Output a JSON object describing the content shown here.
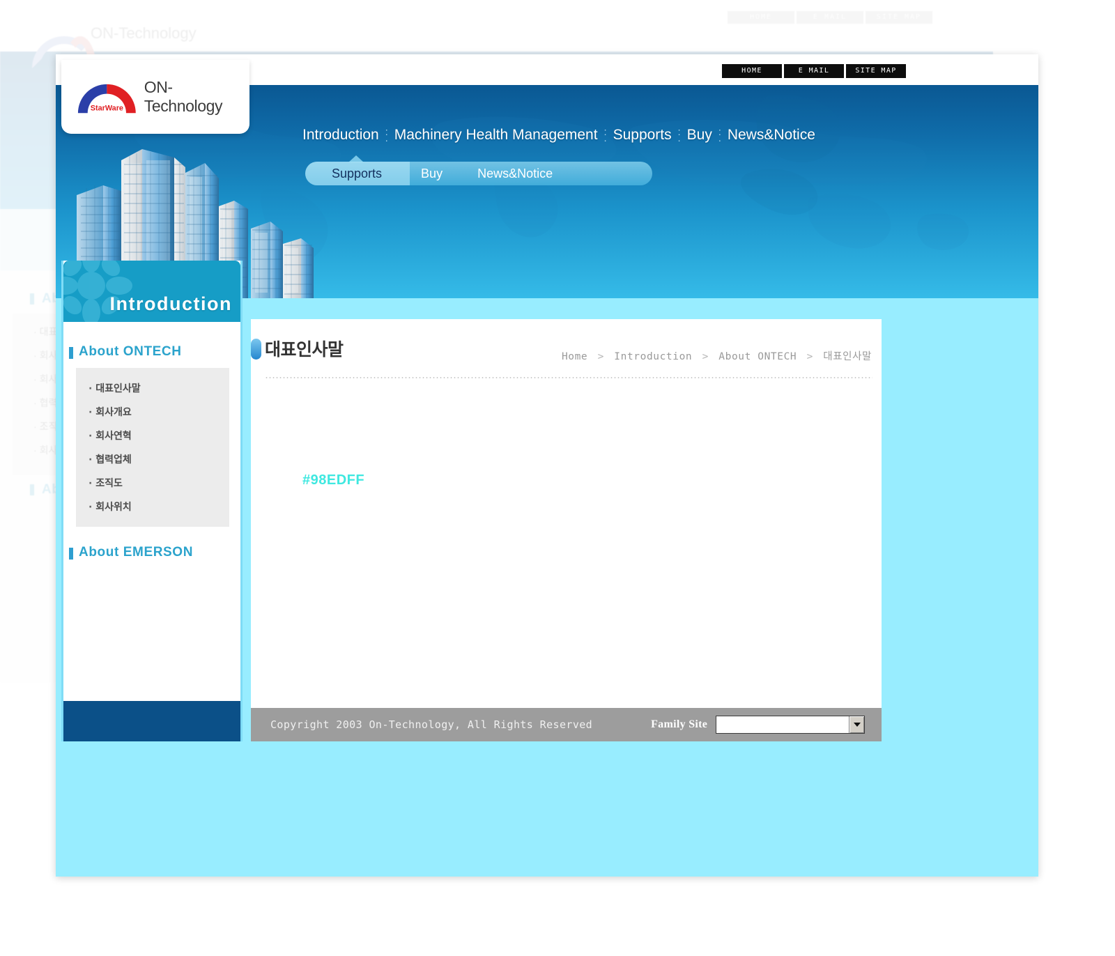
{
  "site": {
    "logo_text": "ON-Technology",
    "logo_badge": "StarWare"
  },
  "utility_nav": [
    {
      "label": "HOME"
    },
    {
      "label": "E MAIL"
    },
    {
      "label": "SITE MAP"
    }
  ],
  "main_nav": [
    {
      "label": "Introduction"
    },
    {
      "label": "Machinery Health Management"
    },
    {
      "label": "Supports"
    },
    {
      "label": "Buy"
    },
    {
      "label": "News&Notice"
    }
  ],
  "sub_nav": [
    {
      "label": "Supports",
      "active": true
    },
    {
      "label": "Buy",
      "active": false
    },
    {
      "label": "News&Notice",
      "active": false
    }
  ],
  "sidebar": {
    "header": "Introduction",
    "sections": [
      {
        "title": "About ONTECH",
        "items": [
          {
            "label": "대표인사말"
          },
          {
            "label": "회사개요"
          },
          {
            "label": "회사연혁"
          },
          {
            "label": "협력업체"
          },
          {
            "label": "조직도"
          },
          {
            "label": "회사위치"
          }
        ]
      },
      {
        "title": "About EMERSON",
        "items": []
      }
    ]
  },
  "page": {
    "title": "대표인사말",
    "breadcrumb": [
      "Home",
      "Introduction",
      "About ONTECH",
      "대표인사말"
    ],
    "breadcrumb_separator": ">",
    "content_swatch_label": "#98EDFF"
  },
  "footer": {
    "copyright": "Copyright 2003 On-Technology, All Rights Reserved",
    "family_site_label": "Family Site",
    "family_site_value": ""
  },
  "colors": {
    "page_background": "#98EDFF",
    "banner_top": "#0A5893",
    "banner_bottom": "#35BBE8",
    "sidebar_header": "#169DC6",
    "sidebar_foot": "#0B5088",
    "accent_cyan": "#2BA3CC",
    "footer_gray": "#9D9D9D",
    "swatch_text": "#3FE8E0"
  }
}
